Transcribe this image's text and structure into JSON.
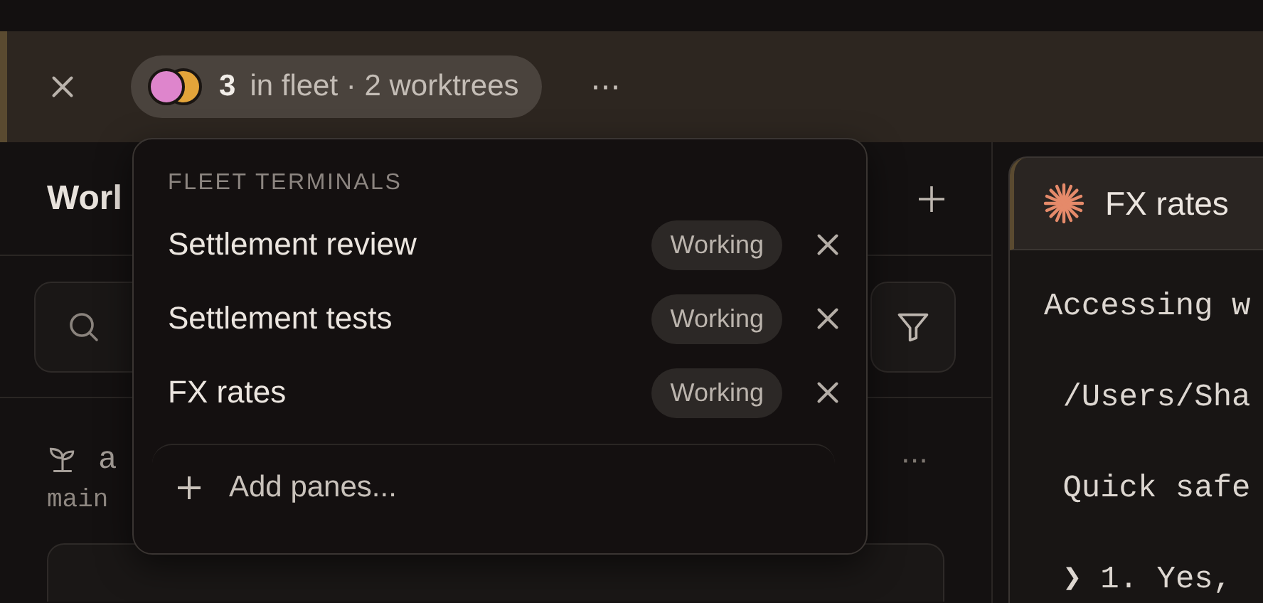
{
  "toolbar": {
    "fleet": {
      "dots": [
        {
          "color": "#de85cc"
        },
        {
          "color": "#e3a43a"
        }
      ],
      "count": "3",
      "label": "in fleet · 2 worktrees"
    },
    "more": "···"
  },
  "fleet_menu": {
    "heading": "FLEET TERMINALS",
    "items": [
      {
        "name": "Settlement review",
        "status": "Working"
      },
      {
        "name": "Settlement tests",
        "status": "Working"
      },
      {
        "name": "FX rates",
        "status": "Working"
      }
    ],
    "add": "Add panes..."
  },
  "sidebar": {
    "title": "Worl",
    "worktree": {
      "name": "a",
      "branch": "main"
    }
  },
  "pane": {
    "tab": "FX rates",
    "lines": [
      "Accessing w",
      " /Users/Sha",
      " Quick safe",
      " ❯ 1. Yes,"
    ]
  }
}
